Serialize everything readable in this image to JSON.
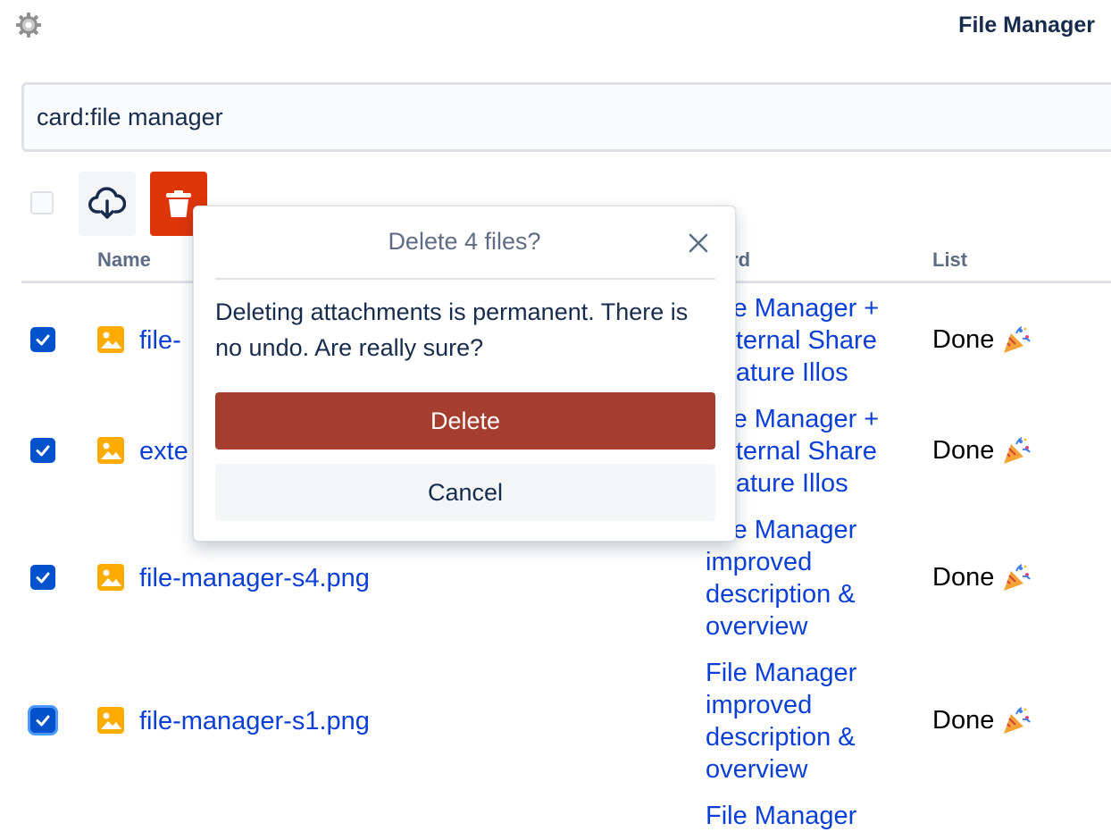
{
  "header": {
    "title": "File Manager",
    "settings_icon": "gear-icon"
  },
  "search": {
    "value": "card:file manager"
  },
  "toolbar": {
    "download_icon": "cloud-download-icon",
    "delete_icon": "trash-icon"
  },
  "table": {
    "columns": [
      "Name",
      "Card",
      "List"
    ],
    "rows": [
      {
        "checked": true,
        "file": "file-",
        "card": "File Manager + External Share Feature Illos",
        "list": "Done"
      },
      {
        "checked": true,
        "file": "exte",
        "card": "File Manager + External Share Feature Illos",
        "list": "Done"
      },
      {
        "checked": true,
        "file": "file-manager-s4.png",
        "card": "File Manager improved description & overview",
        "list": "Done"
      },
      {
        "checked": true,
        "file": "file-manager-s1.png",
        "card": "File Manager improved description & overview",
        "list": "Done"
      },
      {
        "checked": false,
        "file": "",
        "card": "File Manager",
        "list": ""
      }
    ]
  },
  "dialog": {
    "title": "Delete 4 files?",
    "body": "Deleting attachments is permanent. There is no undo. Are really sure?",
    "confirm_label": "Delete",
    "cancel_label": "Cancel"
  },
  "colors": {
    "accent": "#0052cc",
    "danger": "#de350b",
    "confirm": "#a63e30",
    "link": "#0b3fd6",
    "file_icon": "#ffab00"
  }
}
